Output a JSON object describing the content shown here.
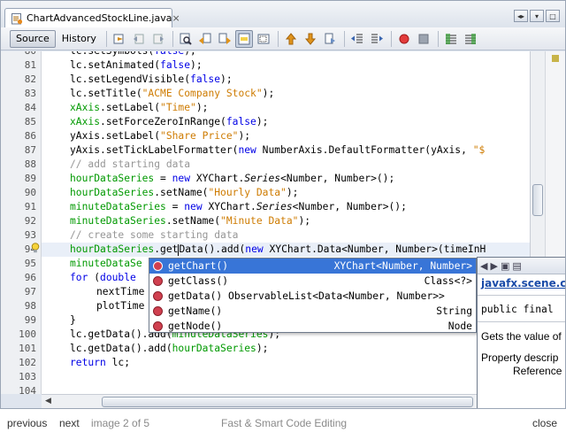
{
  "tab": {
    "title": "ChartAdvancedStockLine.java",
    "close": "×",
    "icon": "java-file-icon"
  },
  "window_controls": [
    "◂▸",
    "▾",
    "□"
  ],
  "toolbar": {
    "source_label": "Source",
    "history_label": "History",
    "icons": [
      "last-edit-icon",
      "back-icon",
      "forward-icon",
      "find-selection-icon",
      "find-previous-icon",
      "find-next-icon",
      "toggle-highlight-icon",
      "toggle-rectangle-icon",
      "previous-bookmark-icon",
      "next-bookmark-icon",
      "toggle-bookmark-icon",
      "shift-left-icon",
      "shift-right-icon",
      "start-macro-icon",
      "stop-macro-icon",
      "comment-icon",
      "uncomment-icon"
    ]
  },
  "editor": {
    "line_numbers": [
      "80",
      "81",
      "82",
      "83",
      "84",
      "85",
      "86",
      "87",
      "88",
      "89",
      "90",
      "91",
      "92",
      "93",
      "94",
      "95",
      "96",
      "97",
      "98",
      "99",
      "100",
      "101",
      "102",
      "103",
      "104"
    ],
    "current_line": "94"
  },
  "completion": {
    "items": [
      {
        "name": "getChart()",
        "type": "XYChart<Number, Number>",
        "selected": true
      },
      {
        "name": "getClass()",
        "type": "Class<?>",
        "selected": false
      },
      {
        "name": "getData() ObservableList<Data<Number, Number>>",
        "type": "",
        "selected": false
      },
      {
        "name": "getName()",
        "type": "String",
        "selected": false
      },
      {
        "name": "getNode()",
        "type": "Node",
        "selected": false
      }
    ]
  },
  "javadoc": {
    "package": "javafx.scene.c",
    "signature": "public final",
    "description": "Gets the value of",
    "property_desc": "Property descrip",
    "reference": "Reference"
  },
  "footer": {
    "previous": "previous",
    "next": "next",
    "counter": "image 2 of 5",
    "title": "Fast & Smart Code Editing",
    "close": "close"
  },
  "colors": {
    "keyword": "#0000e6",
    "string": "#ce7b00",
    "field": "#009900",
    "comment": "#969696",
    "selection": "#3875d7"
  }
}
